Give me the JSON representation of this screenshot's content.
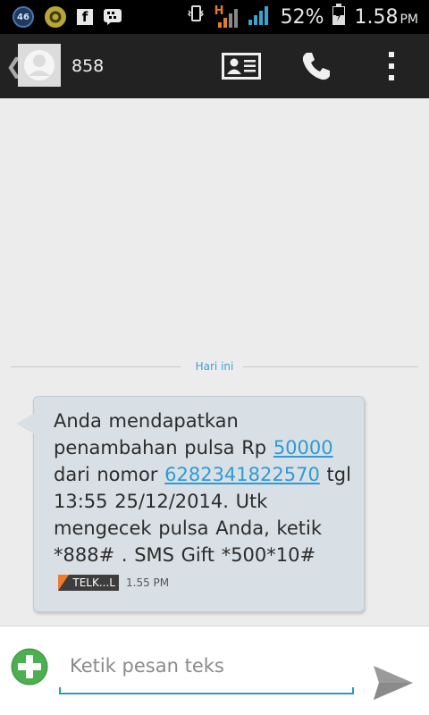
{
  "status_bar": {
    "network_badge": "46",
    "battery_percent": "52%",
    "time": "1.58",
    "ampm": "PM",
    "network_type": "H"
  },
  "action_bar": {
    "contact_name": "858",
    "icons": [
      "back-icon",
      "contact-card-icon",
      "phone-icon",
      "overflow-menu-icon"
    ]
  },
  "conversation": {
    "date_separator": "Hari ini",
    "message": {
      "text_part1": "Anda mendapatkan penambahan pulsa Rp ",
      "link_amount": "50000",
      "text_part2": " dari nomor ",
      "link_number": "6282341822570",
      "text_part3": " tgl 13:55 25/12/2014. Utk mengecek pulsa Anda, ketik *888# . SMS Gift *500*10#",
      "operator_label": "TELK...L",
      "time": "1.55 PM"
    }
  },
  "composer": {
    "placeholder": "Ketik pesan teks",
    "value": ""
  },
  "colors": {
    "accent": "#2f9ad6",
    "bubble": "#d9e0e5",
    "add_button": "#4caf50",
    "operator_flag": "#f07b2e"
  }
}
